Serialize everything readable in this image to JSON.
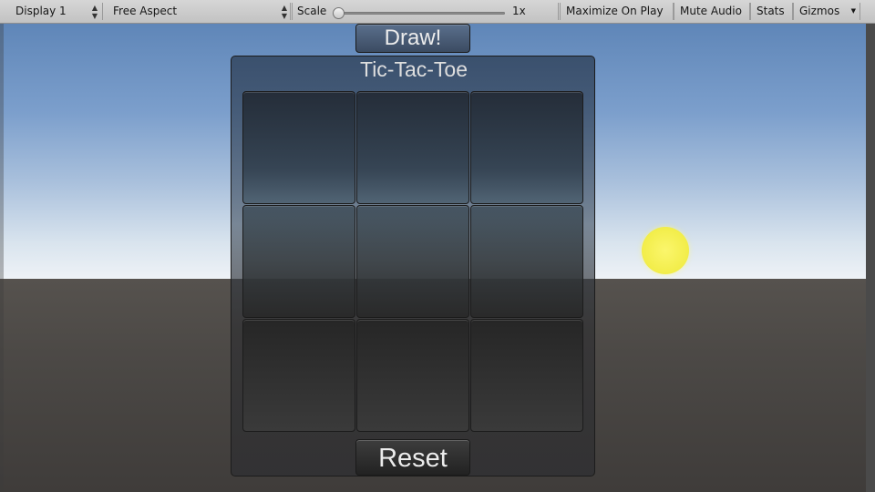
{
  "toolbar": {
    "display": "Display 1",
    "aspect": "Free Aspect",
    "scale_label": "Scale",
    "scale_value": "1x",
    "maximize_on_play": "Maximize On Play",
    "mute_audio": "Mute Audio",
    "stats": "Stats",
    "gizmos": "Gizmos",
    "arrows_icon": "updown-arrows-icon",
    "dropdown_icon": "triangle-down-icon"
  },
  "game": {
    "draw_label": "Draw!",
    "title": "Tic-Tac-Toe",
    "reset_label": "Reset",
    "cells": [
      [
        "",
        "",
        ""
      ],
      [
        "",
        "",
        ""
      ],
      [
        "",
        "",
        ""
      ]
    ]
  },
  "colors": {
    "sun": "#f5f04a",
    "sky_top": "#5f86b8",
    "ground": "#4c4946",
    "toolbar": "#c8c8c8"
  }
}
